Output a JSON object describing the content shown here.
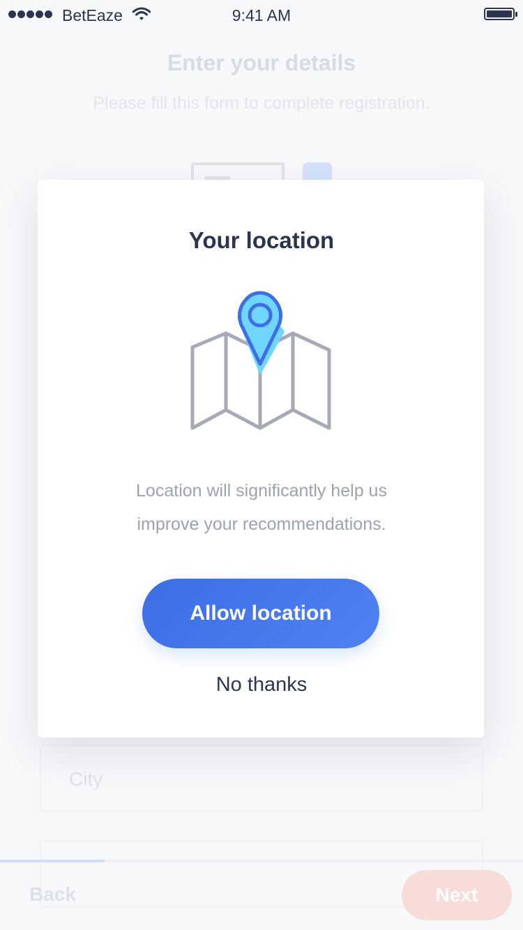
{
  "status_bar": {
    "carrier": "BetEaze",
    "time": "9:41 AM",
    "signal_icon": "signal-dots-icon",
    "wifi_icon": "wifi-icon",
    "battery_icon": "battery-icon"
  },
  "background_form": {
    "title": "Enter your details",
    "subtitle": "Please fill this form to complete registration.",
    "city_placeholder": "City",
    "back_label": "Back",
    "next_label": "Next",
    "progress": 0.2
  },
  "location_modal": {
    "title": "Your location",
    "illustration_icon": "map-pin-icon",
    "description_line1": "Location will significantly help us",
    "description_line2": "improve your recommendations.",
    "allow_label": "Allow location",
    "decline_label": "No thanks"
  },
  "colors": {
    "primary": "#3d6ee5",
    "text_dark": "#2c3550",
    "text_muted": "#9ea2ad",
    "pin_fill": "#6fd6ff",
    "next_button_faded": "#f8dcd7"
  }
}
